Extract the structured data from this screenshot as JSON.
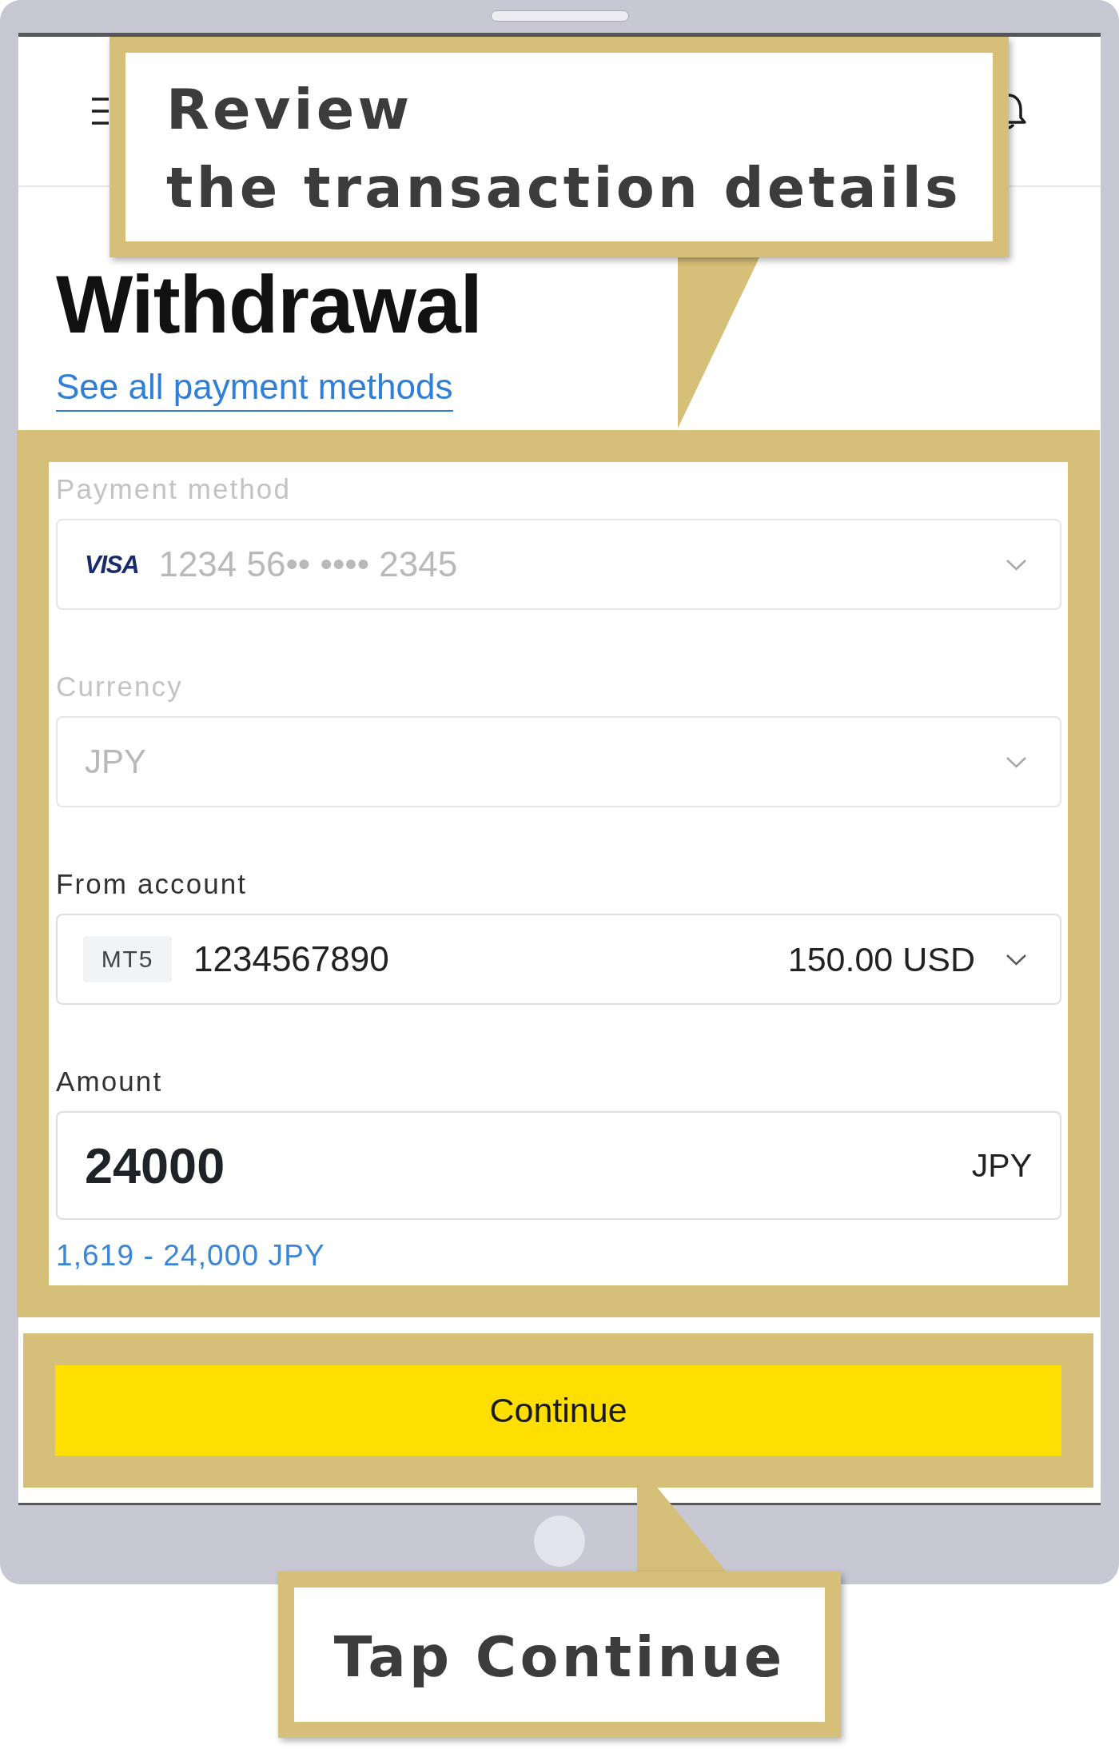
{
  "page": {
    "title": "Withdrawal",
    "link": "See all payment methods"
  },
  "form": {
    "fields": [
      {
        "kind": "card_select",
        "label": "Payment method",
        "disabled": true,
        "brand": "VISA",
        "value": "1234 56•• •••• 2345"
      },
      {
        "kind": "select",
        "label": "Currency",
        "disabled": true,
        "value": "JPY"
      },
      {
        "kind": "account_select",
        "label": "From account",
        "disabled": false,
        "badge": "MT5",
        "value": "1234567890",
        "balance": "150.00 USD"
      },
      {
        "kind": "amount_input",
        "label": "Amount",
        "disabled": false,
        "value": "24000",
        "suffix": "JPY",
        "hint": "1,619 - 24,000 JPY"
      }
    ]
  },
  "continue_button": {
    "label": "Continue"
  },
  "callouts": [
    {
      "text": "Review\nthe transaction details"
    },
    {
      "text": "Tap Continue"
    }
  ]
}
